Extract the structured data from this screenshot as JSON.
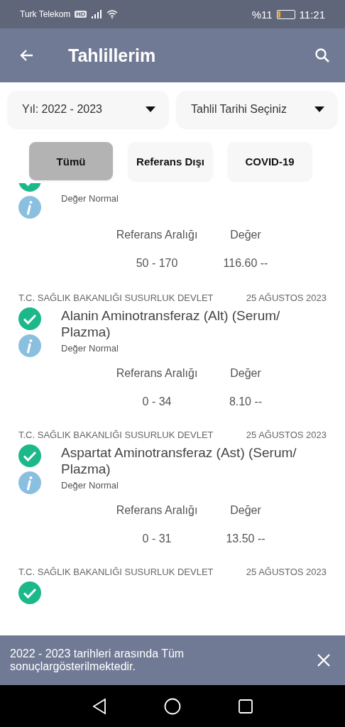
{
  "status_bar": {
    "carrier": "Turk Telekom",
    "network_badge": "HD",
    "battery_text": "%11",
    "time": "11:21"
  },
  "app_bar": {
    "title": "Tahlillerim"
  },
  "filters": [
    {
      "label": "Yıl: 2022 - 2023"
    },
    {
      "label": "Tahlil Tarihi Seçiniz"
    }
  ],
  "tabs": [
    {
      "label": "Tümü",
      "selected": true
    },
    {
      "label": "Referans Dışı",
      "selected": false
    },
    {
      "label": "COVID-19",
      "selected": false
    }
  ],
  "results": [
    {
      "kind": "cut_top",
      "status": "Değer Normal",
      "ref_header": "Referans Aralığı",
      "value_header": "Değer",
      "range": "50 - 170",
      "value": "116.60 --"
    },
    {
      "kind": "full",
      "institution": "T.C. SAĞLIK BAKANLIĞI SUSURLUK DEVLET",
      "date": "25 AĞUSTOS 2023",
      "name": "Alanin Aminotransferaz (Alt) (Serum/ Plazma)",
      "status": "Değer Normal",
      "ref_header": "Referans Aralığı",
      "value_header": "Değer",
      "range": "0 - 34",
      "value": "8.10 --"
    },
    {
      "kind": "full",
      "institution": "T.C. SAĞLIK BAKANLIĞI SUSURLUK DEVLET",
      "date": "25 AĞUSTOS 2023",
      "name": "Aspartat Aminotransferaz (Ast) (Serum/ Plazma)",
      "status": "Değer Normal",
      "ref_header": "Referans Aralığı",
      "value_header": "Değer",
      "range": "0 - 31",
      "value": "13.50 --"
    },
    {
      "kind": "cut_bottom",
      "institution": "T.C. SAĞLIK BAKANLIĞI SUSURLUK DEVLET",
      "date": "25 AĞUSTOS 2023"
    }
  ],
  "snackbar": {
    "message": "2022 - 2023 tarihleri arasında Tüm sonuçlargösterilmektedir."
  }
}
